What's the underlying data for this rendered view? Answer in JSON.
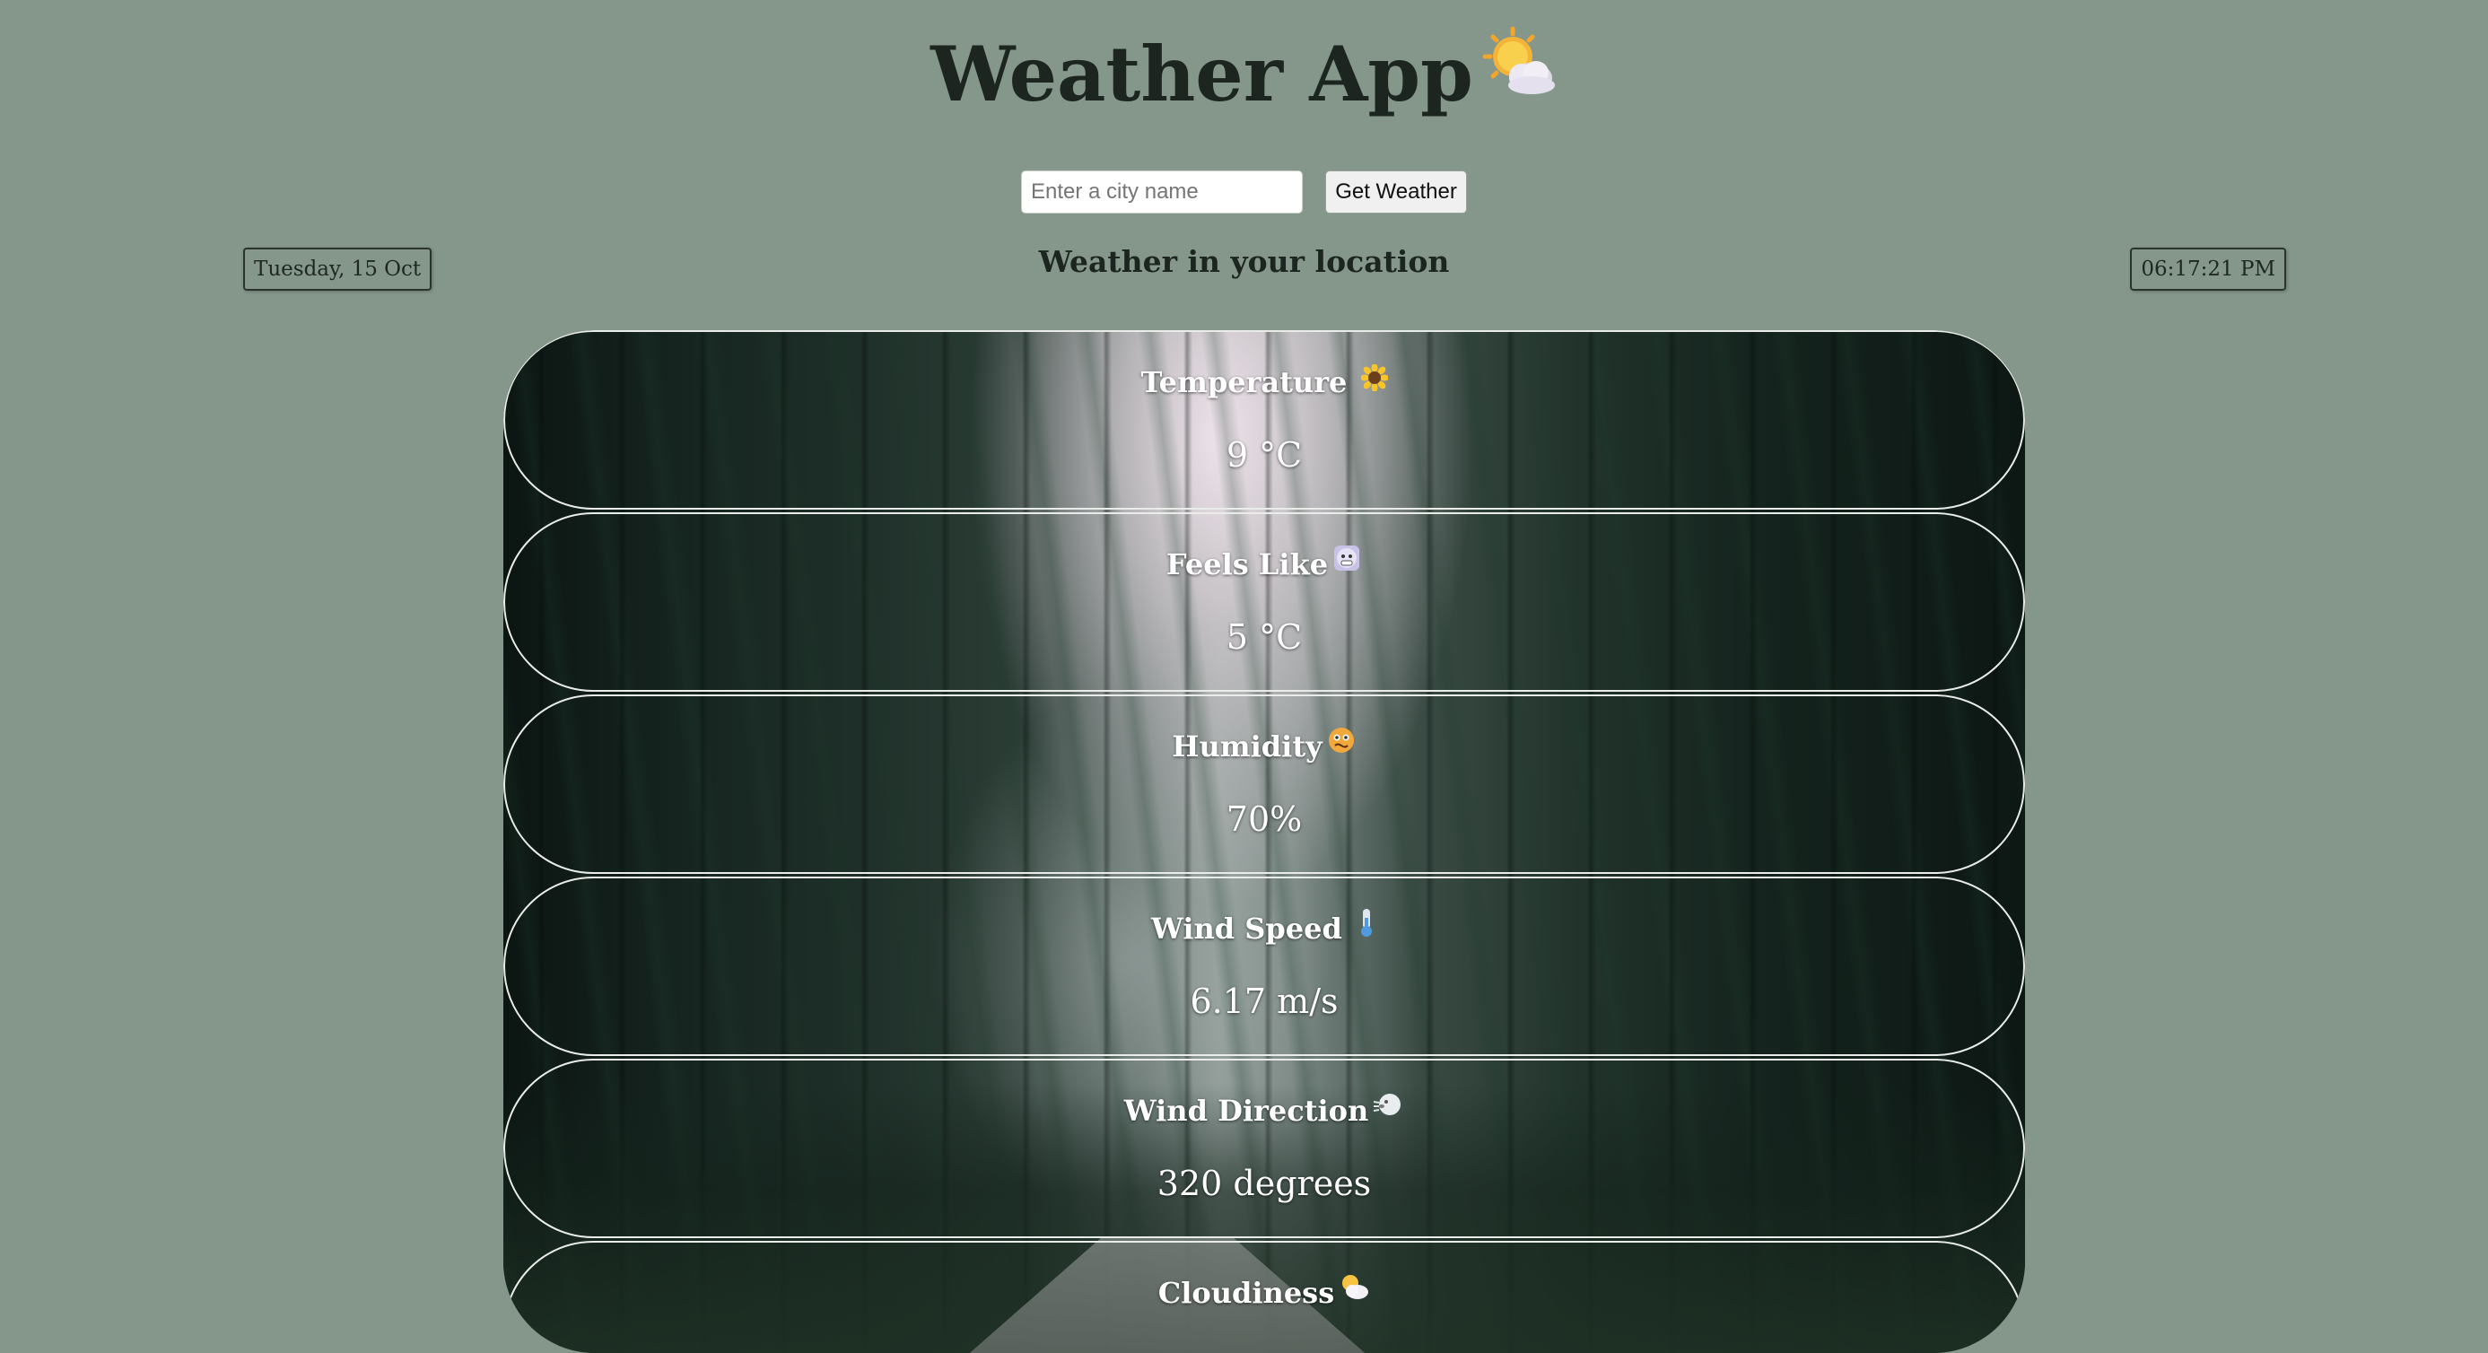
{
  "app": {
    "title": "Weather App",
    "title_icon": "sun-behind-cloud-icon"
  },
  "search": {
    "placeholder": "Enter a city name",
    "value": "",
    "button_label": "Get Weather"
  },
  "date_display": "Tuesday, 15 Oct",
  "time_display": "06:17:21 PM",
  "location_heading": "Weather in your location",
  "metrics": [
    {
      "label": "Temperature",
      "value": "9 °C",
      "icon": "sunflower-icon"
    },
    {
      "label": "Feels Like",
      "value": "5 °C",
      "icon": "cold-face-icon"
    },
    {
      "label": "Humidity",
      "value": "70%",
      "icon": "hot-face-icon"
    },
    {
      "label": "Wind Speed",
      "value": "6.17 m/s",
      "icon": "thermometer-icon"
    },
    {
      "label": "Wind Direction",
      "value": "320 degrees",
      "icon": "wind-face-icon"
    },
    {
      "label": "Cloudiness",
      "value": "",
      "icon": "sun-behind-cloud-icon"
    }
  ],
  "colors": {
    "page_background": "#84978a",
    "title_text": "#1c2520",
    "card_border": "#e9ece9",
    "card_text": "#ffffff"
  }
}
